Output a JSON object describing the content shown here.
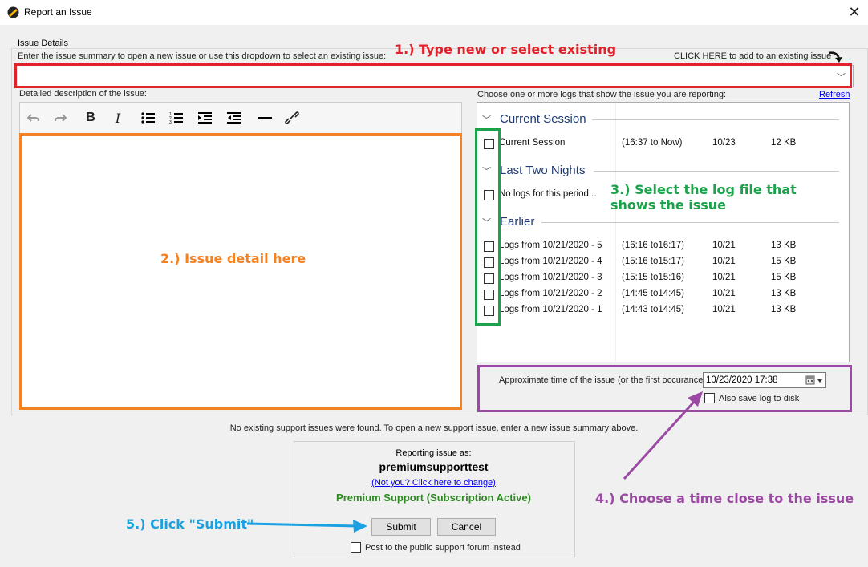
{
  "window": {
    "title": "Report an Issue",
    "close_glyph": "✕"
  },
  "group": {
    "legend": "Issue Details"
  },
  "summary": {
    "label": "Enter the issue summary to open a new issue or use this dropdown to select an existing issue:",
    "value": "",
    "click_here": "CLICK HERE to add to an existing issue"
  },
  "editor": {
    "label": "Detailed description of the issue:",
    "toolbar": [
      "undo-icon",
      "redo-icon",
      "bold-icon",
      "italic-icon",
      "bullet-list-icon",
      "numbered-list-icon",
      "indent-icon",
      "outdent-icon",
      "horizontal-rule-icon",
      "link-icon"
    ]
  },
  "logs": {
    "label": "Choose one or more logs that show the issue you are reporting:",
    "refresh": "Refresh",
    "sections": [
      {
        "title": "Current Session",
        "rows": [
          {
            "name": "Current Session",
            "range": "(16:37 to Now)",
            "date": "10/23",
            "size": "12 KB"
          }
        ]
      },
      {
        "title": "Last Two Nights",
        "rows": [
          {
            "name": "No logs for this period...",
            "range": "",
            "date": "",
            "size": ""
          }
        ]
      },
      {
        "title": "Earlier",
        "rows": [
          {
            "name": "Logs from 10/21/2020 - 5",
            "range": "(16:16 to16:17)",
            "date": "10/21",
            "size": "13 KB"
          },
          {
            "name": "Logs from 10/21/2020 - 4",
            "range": "(15:16 to15:17)",
            "date": "10/21",
            "size": "15 KB"
          },
          {
            "name": "Logs from 10/21/2020 - 3",
            "range": "(15:15 to15:16)",
            "date": "10/21",
            "size": "15 KB"
          },
          {
            "name": "Logs from 10/21/2020 - 2",
            "range": "(14:45 to14:45)",
            "date": "10/21",
            "size": "13 KB"
          },
          {
            "name": "Logs from 10/21/2020 - 1",
            "range": "(14:43 to14:45)",
            "date": "10/21",
            "size": "13 KB"
          }
        ]
      }
    ]
  },
  "time": {
    "label": "Approximate time of the issue (or the first occurance)",
    "value": "10/23/2020 17:38",
    "save_label": "Also save log to disk"
  },
  "status": "No existing support issues were found. To open a new support issue, enter a new issue summary above.",
  "reporter": {
    "label": "Reporting issue as:",
    "user": "premiumsupporttest",
    "change_link": "(Not you? Click here to change)",
    "plan": "Premium Support (Subscription Active)"
  },
  "buttons": {
    "submit": "Submit",
    "cancel": "Cancel"
  },
  "post_public": "Post to the public support forum instead",
  "annotations": {
    "step1": "1.) Type new or select existing",
    "step2": "2.) Issue detail here",
    "step3": "3.) Select the log file that shows the issue",
    "step4": "4.) Choose a time close to the issue",
    "step5": "5.) Click \"Submit\""
  },
  "colors": {
    "red": "#e2222a",
    "orange": "#f58220",
    "green": "#1aa34a",
    "purple": "#9b4aa3",
    "blue": "#1ba1e2",
    "plan_green": "#2e8b22"
  }
}
